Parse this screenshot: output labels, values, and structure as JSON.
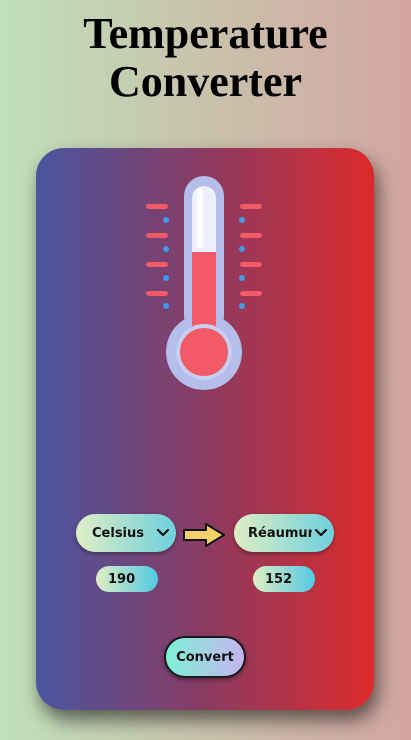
{
  "page": {
    "title_line1": "Temperature",
    "title_line2": "Converter"
  },
  "converter": {
    "from_unit": "Celsius",
    "to_unit": "Réaumur",
    "from_value": "190",
    "to_value": "152",
    "convert_label": "Convert"
  },
  "icons": {
    "thermometer": "thermometer-icon",
    "arrow": "arrow-right-icon",
    "chevron": "chevron-down-icon"
  },
  "colors": {
    "card_left": "#4a55a0",
    "card_right": "#dd2a2a",
    "mercury": "#f25a67",
    "tick_red": "#f25a67",
    "tick_blue": "#3d9be9"
  }
}
